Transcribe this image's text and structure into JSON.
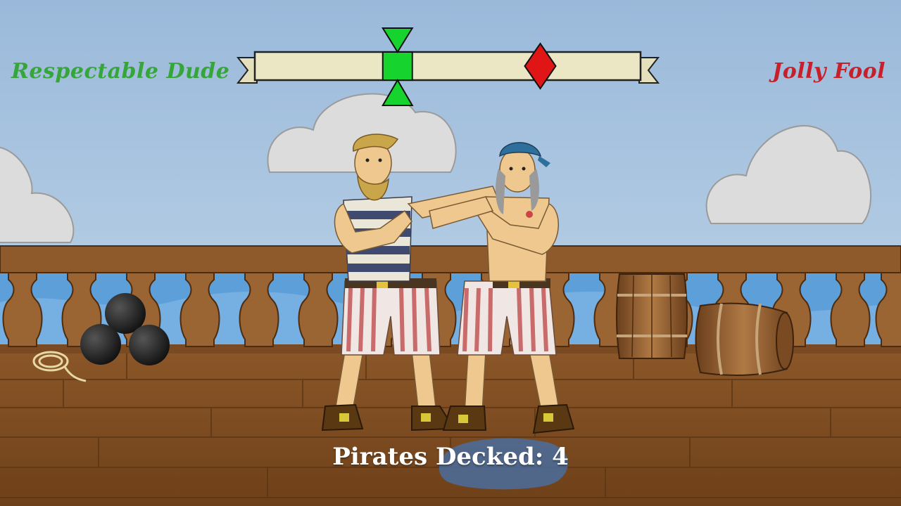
{
  "players": {
    "left": {
      "name": "Respectable Dude",
      "color": "#37a63a"
    },
    "right": {
      "name": "Jolly Fool",
      "color": "#c8202a"
    }
  },
  "tug_meter": {
    "player_marker_position": 0.37,
    "opponent_marker_position": 0.74,
    "player_marker_color": "#16d32e",
    "opponent_marker_color": "#e01616",
    "banner_color": "#ebe7c4"
  },
  "score": {
    "label": "Pirates Decked:",
    "value": "4"
  },
  "scene_icons": [
    "cloud-icon",
    "cannonball-icon",
    "rope-coil-icon",
    "barrel-icon",
    "railing",
    "deck"
  ]
}
